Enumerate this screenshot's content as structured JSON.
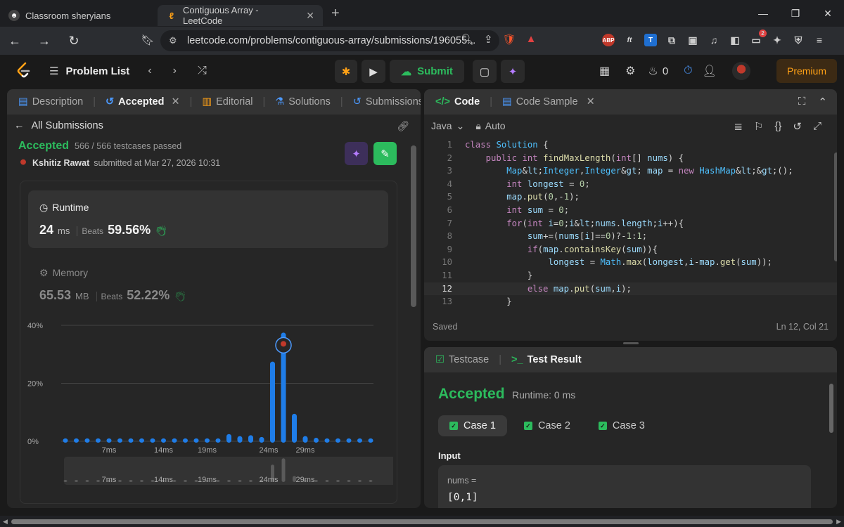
{
  "browser": {
    "tabs": [
      {
        "title": "Classroom sheryians",
        "active": false
      },
      {
        "title": "Contiguous Array - LeetCode",
        "active": true
      }
    ],
    "url": "leetcode.com/problems/contiguous-array/submissions/196055...",
    "brave_badge": "4",
    "ext_badge": "2"
  },
  "header": {
    "problem_list": "Problem List",
    "submit_label": "Submit",
    "streak_count": "0",
    "premium_label": "Premium"
  },
  "left": {
    "tabs": [
      {
        "label": "Description",
        "icon": "document-icon"
      },
      {
        "label": "Accepted",
        "icon": "history-icon"
      },
      {
        "label": "Editorial",
        "icon": "book-icon"
      },
      {
        "label": "Solutions",
        "icon": "flask-icon"
      },
      {
        "label": "Submissions",
        "icon": "history-icon"
      }
    ],
    "all_submissions": "All Submissions",
    "status": "Accepted",
    "testcases": "566 / 566 testcases passed",
    "author": "Kshitiz Rawat",
    "submitted_at": "submitted at Mar 27, 2026 10:31",
    "runtime": {
      "label": "Runtime",
      "value": "24",
      "unit": "ms",
      "beats_label": "Beats",
      "beats": "59.56%"
    },
    "memory": {
      "label": "Memory",
      "value": "65.53",
      "unit": "MB",
      "beats_label": "Beats",
      "beats": "52.22%"
    }
  },
  "chart_data": {
    "type": "bar",
    "ylabel": "",
    "xlabel": "",
    "y_ticks": [
      "40%",
      "20%",
      "0%"
    ],
    "ylim": [
      0,
      40
    ],
    "x_tick_labels": [
      "7ms",
      "14ms",
      "19ms",
      "24ms",
      "29ms"
    ],
    "values": [
      1,
      1,
      1,
      1,
      1,
      1,
      1,
      1,
      1,
      1,
      1,
      1,
      1,
      1,
      1,
      2.5,
      1.8,
      2.1,
      1.5,
      27.5,
      37.5,
      9.5,
      1.8,
      1.2,
      1,
      1,
      1,
      1,
      1
    ],
    "highlight_index": 20,
    "accent": "#1f7de8",
    "grid": true
  },
  "code": {
    "tabs": [
      {
        "label": "Code",
        "icon": "code-icon"
      },
      {
        "label": "Code Sample",
        "icon": "document-icon"
      }
    ],
    "language": "Java",
    "mode": "Auto",
    "lines": [
      "class Solution {",
      "    public int findMaxLength(int[] nums) {",
      "        Map<Integer,Integer> map = new HashMap<>();",
      "        int longest = 0;",
      "        map.put(0,-1);",
      "        int sum = 0;",
      "        for(int i=0;i<nums.length;i++){",
      "            sum+=(nums[i]==0)?-1:1;",
      "            if(map.containsKey(sum)){",
      "                longest = Math.max(longest,i-map.get(sum));",
      "            }",
      "            else map.put(sum,i);",
      "        }"
    ],
    "current_line": 12,
    "status": "Saved",
    "cursor": "Ln 12, Col 21"
  },
  "test": {
    "tabs": [
      {
        "label": "Testcase",
        "icon": "checkbox-icon"
      },
      {
        "label": "Test Result",
        "icon": "terminal-icon"
      }
    ],
    "status": "Accepted",
    "runtime": "Runtime: 0 ms",
    "cases": [
      "Case 1",
      "Case 2",
      "Case 3"
    ],
    "input_label": "Input",
    "input_name": "nums =",
    "input_value": "[0,1]"
  }
}
